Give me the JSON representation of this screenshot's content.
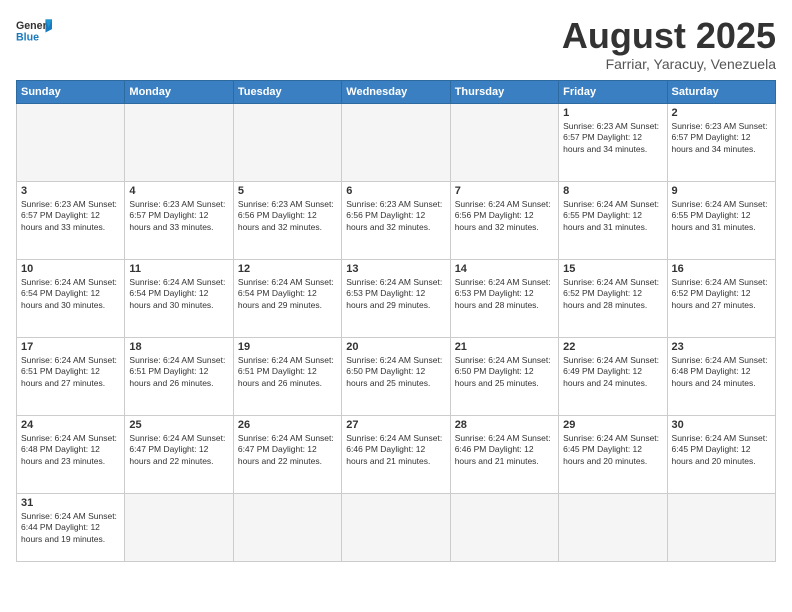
{
  "header": {
    "logo_general": "General",
    "logo_blue": "Blue",
    "month_title": "August 2025",
    "subtitle": "Farriar, Yaracuy, Venezuela"
  },
  "weekdays": [
    "Sunday",
    "Monday",
    "Tuesday",
    "Wednesday",
    "Thursday",
    "Friday",
    "Saturday"
  ],
  "weeks": [
    [
      {
        "day": "",
        "info": "",
        "empty": true
      },
      {
        "day": "",
        "info": "",
        "empty": true
      },
      {
        "day": "",
        "info": "",
        "empty": true
      },
      {
        "day": "",
        "info": "",
        "empty": true
      },
      {
        "day": "",
        "info": "",
        "empty": true
      },
      {
        "day": "1",
        "info": "Sunrise: 6:23 AM\nSunset: 6:57 PM\nDaylight: 12 hours\nand 34 minutes.",
        "empty": false
      },
      {
        "day": "2",
        "info": "Sunrise: 6:23 AM\nSunset: 6:57 PM\nDaylight: 12 hours\nand 34 minutes.",
        "empty": false
      }
    ],
    [
      {
        "day": "3",
        "info": "Sunrise: 6:23 AM\nSunset: 6:57 PM\nDaylight: 12 hours\nand 33 minutes.",
        "empty": false
      },
      {
        "day": "4",
        "info": "Sunrise: 6:23 AM\nSunset: 6:57 PM\nDaylight: 12 hours\nand 33 minutes.",
        "empty": false
      },
      {
        "day": "5",
        "info": "Sunrise: 6:23 AM\nSunset: 6:56 PM\nDaylight: 12 hours\nand 32 minutes.",
        "empty": false
      },
      {
        "day": "6",
        "info": "Sunrise: 6:23 AM\nSunset: 6:56 PM\nDaylight: 12 hours\nand 32 minutes.",
        "empty": false
      },
      {
        "day": "7",
        "info": "Sunrise: 6:24 AM\nSunset: 6:56 PM\nDaylight: 12 hours\nand 32 minutes.",
        "empty": false
      },
      {
        "day": "8",
        "info": "Sunrise: 6:24 AM\nSunset: 6:55 PM\nDaylight: 12 hours\nand 31 minutes.",
        "empty": false
      },
      {
        "day": "9",
        "info": "Sunrise: 6:24 AM\nSunset: 6:55 PM\nDaylight: 12 hours\nand 31 minutes.",
        "empty": false
      }
    ],
    [
      {
        "day": "10",
        "info": "Sunrise: 6:24 AM\nSunset: 6:54 PM\nDaylight: 12 hours\nand 30 minutes.",
        "empty": false
      },
      {
        "day": "11",
        "info": "Sunrise: 6:24 AM\nSunset: 6:54 PM\nDaylight: 12 hours\nand 30 minutes.",
        "empty": false
      },
      {
        "day": "12",
        "info": "Sunrise: 6:24 AM\nSunset: 6:54 PM\nDaylight: 12 hours\nand 29 minutes.",
        "empty": false
      },
      {
        "day": "13",
        "info": "Sunrise: 6:24 AM\nSunset: 6:53 PM\nDaylight: 12 hours\nand 29 minutes.",
        "empty": false
      },
      {
        "day": "14",
        "info": "Sunrise: 6:24 AM\nSunset: 6:53 PM\nDaylight: 12 hours\nand 28 minutes.",
        "empty": false
      },
      {
        "day": "15",
        "info": "Sunrise: 6:24 AM\nSunset: 6:52 PM\nDaylight: 12 hours\nand 28 minutes.",
        "empty": false
      },
      {
        "day": "16",
        "info": "Sunrise: 6:24 AM\nSunset: 6:52 PM\nDaylight: 12 hours\nand 27 minutes.",
        "empty": false
      }
    ],
    [
      {
        "day": "17",
        "info": "Sunrise: 6:24 AM\nSunset: 6:51 PM\nDaylight: 12 hours\nand 27 minutes.",
        "empty": false
      },
      {
        "day": "18",
        "info": "Sunrise: 6:24 AM\nSunset: 6:51 PM\nDaylight: 12 hours\nand 26 minutes.",
        "empty": false
      },
      {
        "day": "19",
        "info": "Sunrise: 6:24 AM\nSunset: 6:51 PM\nDaylight: 12 hours\nand 26 minutes.",
        "empty": false
      },
      {
        "day": "20",
        "info": "Sunrise: 6:24 AM\nSunset: 6:50 PM\nDaylight: 12 hours\nand 25 minutes.",
        "empty": false
      },
      {
        "day": "21",
        "info": "Sunrise: 6:24 AM\nSunset: 6:50 PM\nDaylight: 12 hours\nand 25 minutes.",
        "empty": false
      },
      {
        "day": "22",
        "info": "Sunrise: 6:24 AM\nSunset: 6:49 PM\nDaylight: 12 hours\nand 24 minutes.",
        "empty": false
      },
      {
        "day": "23",
        "info": "Sunrise: 6:24 AM\nSunset: 6:48 PM\nDaylight: 12 hours\nand 24 minutes.",
        "empty": false
      }
    ],
    [
      {
        "day": "24",
        "info": "Sunrise: 6:24 AM\nSunset: 6:48 PM\nDaylight: 12 hours\nand 23 minutes.",
        "empty": false
      },
      {
        "day": "25",
        "info": "Sunrise: 6:24 AM\nSunset: 6:47 PM\nDaylight: 12 hours\nand 22 minutes.",
        "empty": false
      },
      {
        "day": "26",
        "info": "Sunrise: 6:24 AM\nSunset: 6:47 PM\nDaylight: 12 hours\nand 22 minutes.",
        "empty": false
      },
      {
        "day": "27",
        "info": "Sunrise: 6:24 AM\nSunset: 6:46 PM\nDaylight: 12 hours\nand 21 minutes.",
        "empty": false
      },
      {
        "day": "28",
        "info": "Sunrise: 6:24 AM\nSunset: 6:46 PM\nDaylight: 12 hours\nand 21 minutes.",
        "empty": false
      },
      {
        "day": "29",
        "info": "Sunrise: 6:24 AM\nSunset: 6:45 PM\nDaylight: 12 hours\nand 20 minutes.",
        "empty": false
      },
      {
        "day": "30",
        "info": "Sunrise: 6:24 AM\nSunset: 6:45 PM\nDaylight: 12 hours\nand 20 minutes.",
        "empty": false
      }
    ],
    [
      {
        "day": "31",
        "info": "Sunrise: 6:24 AM\nSunset: 6:44 PM\nDaylight: 12 hours\nand 19 minutes.",
        "empty": false
      },
      {
        "day": "",
        "info": "",
        "empty": true
      },
      {
        "day": "",
        "info": "",
        "empty": true
      },
      {
        "day": "",
        "info": "",
        "empty": true
      },
      {
        "day": "",
        "info": "",
        "empty": true
      },
      {
        "day": "",
        "info": "",
        "empty": true
      },
      {
        "day": "",
        "info": "",
        "empty": true
      }
    ]
  ]
}
